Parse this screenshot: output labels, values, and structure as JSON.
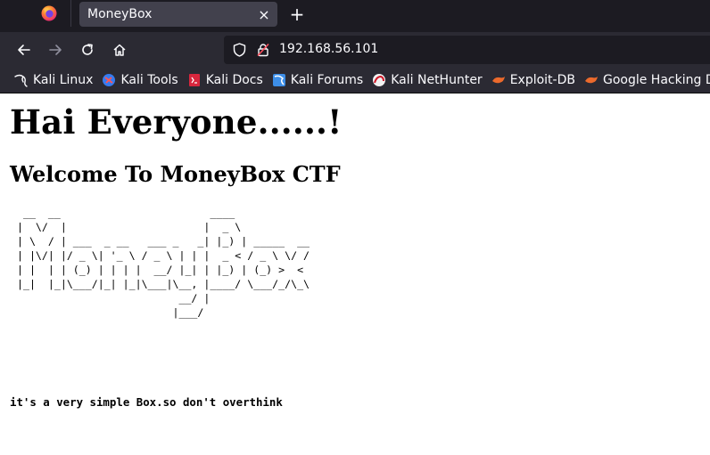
{
  "browser": {
    "tab_title": "MoneyBox",
    "close_tab_glyph": "×",
    "new_tab_glyph": "+",
    "url": "192.168.56.101"
  },
  "bookmarks": [
    {
      "label": "Kali Linux",
      "icon": "kali-dragon-icon"
    },
    {
      "label": "Kali Tools",
      "icon": "kali-tools-icon"
    },
    {
      "label": "Kali Docs",
      "icon": "kali-docs-icon"
    },
    {
      "label": "Kali Forums",
      "icon": "kali-forums-icon"
    },
    {
      "label": "Kali NetHunter",
      "icon": "kali-nethunter-icon"
    },
    {
      "label": "Exploit-DB",
      "icon": "exploit-db-icon"
    },
    {
      "label": "Google Hacking DB",
      "icon": "google-hacking-db-icon"
    }
  ],
  "page": {
    "heading": "Hai Everyone......!",
    "subheading": "Welcome To MoneyBox CTF",
    "ascii_art": [
      "  __  __                        ____",
      " |  \\/  |                      |  _ \\",
      " | \\  / | ___  _ __   ___ _   _| |_) | _____  __",
      " | |\\/| |/ _ \\| '_ \\ / _ \\ | | |  _ < / _ \\ \\/ /",
      " | |  | | (_) | | | |  __/ |_| | |_) | (_) >  <",
      " |_|  |_|\\___/|_| |_|\\___|\\__, |____/ \\___/_/\\_\\",
      "                           __/ |",
      "                          |___/"
    ],
    "message": "it's a very simple Box.so don't overthink"
  },
  "colors": {
    "tabbar_bg": "#1c1b22",
    "toolbar_bg": "#2b2a33",
    "urlbar_bg": "#1c1b22",
    "page_bg": "#ffffff"
  }
}
